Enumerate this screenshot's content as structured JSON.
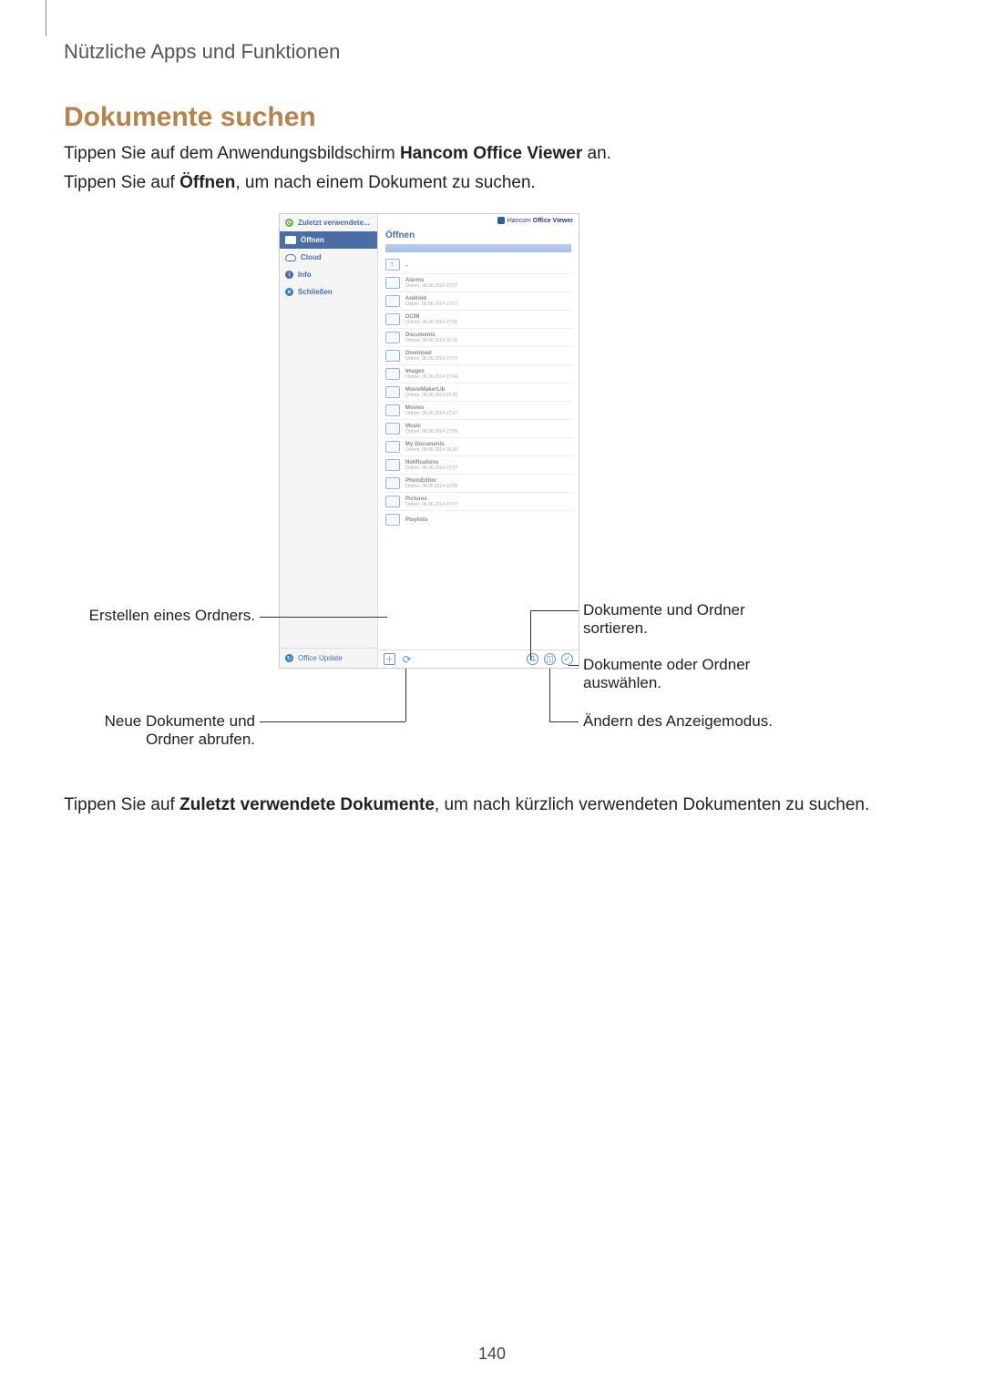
{
  "header": {
    "breadcrumb": "Nützliche Apps und Funktionen"
  },
  "heading": "Dokumente suchen",
  "para1": {
    "pre": "Tippen Sie auf dem Anwendungsbildschirm ",
    "bold": "Hancom Office Viewer",
    "post": " an."
  },
  "para2": {
    "pre": "Tippen Sie auf ",
    "bold": "Öffnen",
    "post": ", um nach einem Dokument zu suchen."
  },
  "para3": {
    "pre": "Tippen Sie auf ",
    "bold": "Zuletzt verwendete Dokumente",
    "post": ", um nach kürzlich verwendeten Dokumenten zu suchen."
  },
  "app": {
    "title_brand": "Hancom",
    "title_suffix": "Office Viewer",
    "pane_heading": "Öffnen",
    "sidebar": {
      "recent": "Zuletzt verwendete...",
      "open": "Öffnen",
      "cloud": "Cloud",
      "info": "Info",
      "close": "Schließen",
      "update": "Office Update"
    },
    "files": [
      {
        "name": "..",
        "sub": ""
      },
      {
        "name": "Alarms",
        "sub": "Ordner, 06.06.2014 17:07"
      },
      {
        "name": "Android",
        "sub": "Ordner, 06.06.2014 17:07"
      },
      {
        "name": "DCIM",
        "sub": "Ordner, 06.06.2014 17:06"
      },
      {
        "name": "Documents",
        "sub": "Ordner, 09.06.2014 16:26"
      },
      {
        "name": "Download",
        "sub": "Ordner, 06.06.2014 17:07"
      },
      {
        "name": "Images",
        "sub": "Ordner, 06.06.2014 17:08"
      },
      {
        "name": "MovieMakerLib",
        "sub": "Ordner, 09.06.2014 10:26"
      },
      {
        "name": "Movies",
        "sub": "Ordner, 06.06.2014 17:07"
      },
      {
        "name": "Music",
        "sub": "Ordner, 06.06.2014 17:08"
      },
      {
        "name": "My Documents",
        "sub": "Ordner, 09.06.2014 16:30"
      },
      {
        "name": "Notifications",
        "sub": "Ordner, 06.06.2014 17:07"
      },
      {
        "name": "PhotoEditor",
        "sub": "Ordner, 06.06.2014 10:08"
      },
      {
        "name": "Pictures",
        "sub": "Ordner, 06.06.2014 17:07"
      },
      {
        "name": "Playlists",
        "sub": ""
      }
    ]
  },
  "callouts": {
    "create_folder": "Erstellen eines Ordners.",
    "refresh_line1": "Neue Dokumente und",
    "refresh_line2": "Ordner abrufen.",
    "sort_line1": "Dokumente und Ordner",
    "sort_line2": "sortieren.",
    "select_line1": "Dokumente oder Ordner",
    "select_line2": "auswählen.",
    "viewmode": "Ändern des Anzeigemodus."
  },
  "page_number": "140"
}
